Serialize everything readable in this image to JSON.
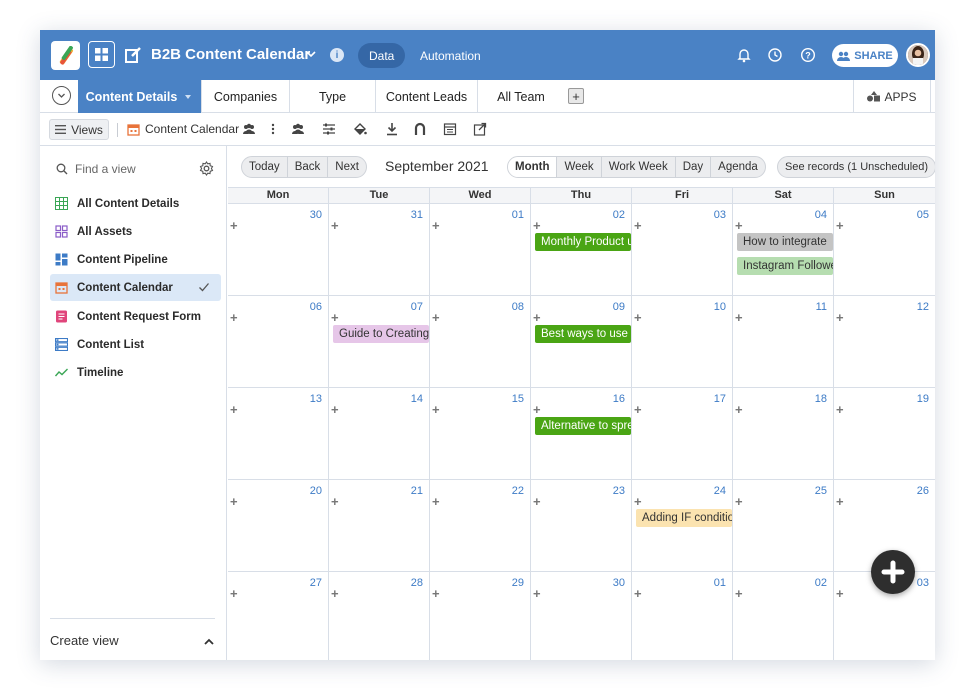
{
  "header": {
    "title": "B2B Content Calendar",
    "tabs": [
      "Data",
      "Automation"
    ],
    "share_label": "SHARE"
  },
  "tabbar": {
    "tabs": [
      "Content Details",
      "Companies",
      "Type",
      "Content Leads",
      "All Team"
    ],
    "active_tab": "Content Details",
    "apps_label": "APPS"
  },
  "toolbar": {
    "views_label": "Views",
    "calendar_name": "Content Calendar"
  },
  "sidebar": {
    "search_placeholder": "Find a view",
    "views": [
      {
        "label": "All Content Details",
        "icon": "grid-view-icon",
        "color": "#3aa655"
      },
      {
        "label": "All Assets",
        "icon": "gallery-view-icon",
        "color": "#8a5cc7"
      },
      {
        "label": "Content Pipeline",
        "icon": "kanban-view-icon",
        "color": "#3d7bc6"
      },
      {
        "label": "Content Calendar",
        "icon": "calendar-view-icon",
        "color": "#e8733a",
        "selected": true
      },
      {
        "label": "Content Request Form",
        "icon": "form-view-icon",
        "color": "#e0457b"
      },
      {
        "label": "Content List",
        "icon": "list-view-icon",
        "color": "#3d7bc6"
      },
      {
        "label": "Timeline",
        "icon": "timeline-view-icon",
        "color": "#3aa655"
      }
    ],
    "create_view_label": "Create view"
  },
  "calendar": {
    "nav_buttons": [
      "Today",
      "Back",
      "Next"
    ],
    "month_title": "September 2021",
    "view_buttons": [
      "Month",
      "Week",
      "Work Week",
      "Day",
      "Agenda"
    ],
    "active_view": "Month",
    "see_records_label": "See records (1 Unscheduled)",
    "weekdays": [
      "Mon",
      "Tue",
      "Wed",
      "Thu",
      "Fri",
      "Sat",
      "Sun"
    ],
    "weeks": [
      [
        "30",
        "31",
        "01",
        "02",
        "03",
        "04",
        "05"
      ],
      [
        "06",
        "07",
        "08",
        "09",
        "10",
        "11",
        "12"
      ],
      [
        "13",
        "14",
        "15",
        "16",
        "17",
        "18",
        "19"
      ],
      [
        "20",
        "21",
        "22",
        "23",
        "24",
        "25",
        "26"
      ],
      [
        "27",
        "28",
        "29",
        "30",
        "01",
        "02",
        "03"
      ]
    ],
    "events": [
      {
        "title": "Monthly Product u",
        "week": 0,
        "day": 3,
        "slot": 0,
        "bg": "#4aa514",
        "fg": "#ffffff"
      },
      {
        "title": "How to integrate",
        "week": 0,
        "day": 5,
        "slot": 0,
        "bg": "#c4c4c4",
        "fg": "#333333"
      },
      {
        "title": "Instagram Followe",
        "week": 0,
        "day": 5,
        "slot": 1,
        "bg": "#b6ddb0",
        "fg": "#333333"
      },
      {
        "title": "Guide to Creating",
        "week": 1,
        "day": 1,
        "slot": 0,
        "bg": "#e6c6e8",
        "fg": "#333333"
      },
      {
        "title": "Best ways to use v",
        "week": 1,
        "day": 3,
        "slot": 0,
        "bg": "#4aa514",
        "fg": "#ffffff"
      },
      {
        "title": "Alternative to spre",
        "week": 2,
        "day": 3,
        "slot": 0,
        "bg": "#4aa514",
        "fg": "#ffffff"
      },
      {
        "title": "Adding IF conditio",
        "week": 3,
        "day": 4,
        "slot": 0,
        "bg": "#fbe3b0",
        "fg": "#333333"
      }
    ]
  },
  "colors": {
    "brand": "#4a82c5",
    "date_number": "#3d7bc6"
  }
}
